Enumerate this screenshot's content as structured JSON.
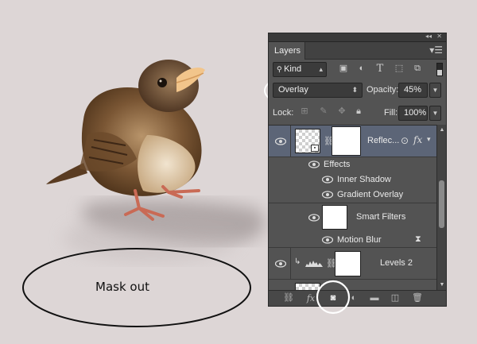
{
  "annotation": {
    "mask_label": "Mask out"
  },
  "panel": {
    "tab_title": "Layers",
    "filter": {
      "kind_label": "Kind"
    },
    "blend_mode": "Overlay",
    "opacity_label": "Opacity:",
    "opacity_value": "45%",
    "lock_label": "Lock:",
    "fill_label": "Fill:",
    "fill_value": "100%",
    "layers": [
      {
        "name": "Reflec...",
        "fx": "fx"
      },
      {
        "name": "Effects"
      },
      {
        "name": "Inner Shadow"
      },
      {
        "name": "Gradient Overlay"
      },
      {
        "name": "Smart Filters"
      },
      {
        "name": "Motion Blur"
      },
      {
        "name": "Levels 2"
      }
    ],
    "bottom_fx": "fx"
  },
  "icons": [
    "eye-icon",
    "chain-link-icon",
    "lock-icon",
    "brush-icon",
    "move-icon",
    "add-mask-icon",
    "adjustment-icon",
    "folder-icon",
    "new-layer-icon",
    "trash-icon",
    "filter-options-icon",
    "levels-icon",
    "smart-object-icon"
  ],
  "colors": {
    "panel_bg": "#535353",
    "selected_row": "#5c6577",
    "canvas_bg": "#ddd6d6"
  }
}
